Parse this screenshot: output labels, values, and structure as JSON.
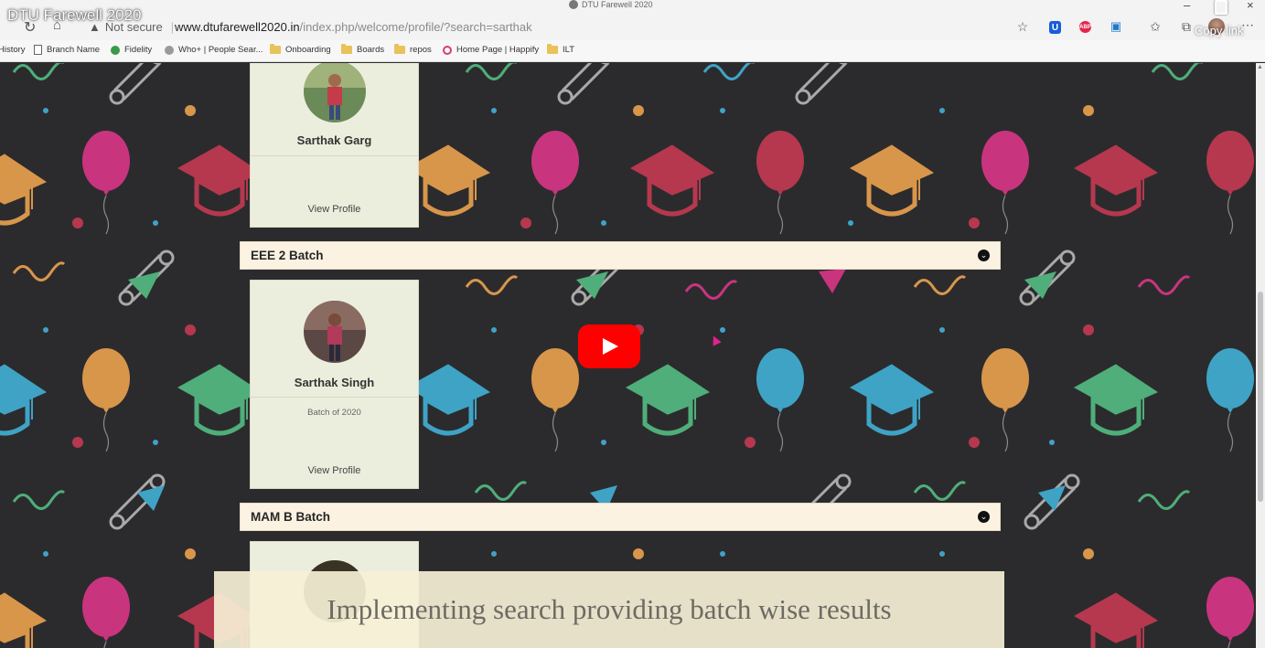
{
  "video": {
    "title": "DTU Farewell 2020",
    "copy_link": "Copy link"
  },
  "window": {
    "title": "DTU Farewell 2020"
  },
  "addressbar": {
    "security_label": "Not secure",
    "url_domain": "www.dtufarewell2020.in",
    "url_path": "/index.php/welcome/profile/?search=sarthak"
  },
  "bookmarks": [
    {
      "label": "History",
      "icon": "none"
    },
    {
      "label": "Branch Name",
      "icon": "document-icon"
    },
    {
      "label": "Fidelity",
      "icon": "fidelity-icon"
    },
    {
      "label": "Who+ | People Sear...",
      "icon": "who-icon"
    },
    {
      "label": "Onboarding",
      "icon": "folder-icon"
    },
    {
      "label": "Boards",
      "icon": "folder-icon"
    },
    {
      "label": "repos",
      "icon": "folder-icon"
    },
    {
      "label": "Home Page | Happify",
      "icon": "happify-icon"
    },
    {
      "label": "ILT",
      "icon": "folder-icon"
    }
  ],
  "profiles": [
    {
      "name": "Sarthak Garg",
      "batch_text": "",
      "view_label": "View Profile"
    },
    {
      "name": "Sarthak Singh",
      "batch_text": "Batch of 2020",
      "view_label": "View Profile"
    }
  ],
  "batches": [
    {
      "label": "EEE 2 Batch",
      "toggle_icon": "chevron-down-circle-icon"
    },
    {
      "label": "MAM B Batch",
      "toggle_icon": "chevron-down-circle-icon"
    }
  ],
  "caption": {
    "text": "Implementing search providing batch wise results"
  },
  "colors": {
    "page_background": "#2b2b2d",
    "card_background": "#eceedd",
    "batch_bar_background": "#fbf2e2",
    "youtube_red": "#ff0000",
    "balloon_pink": "#c9347f",
    "balloon_red": "#b5384f",
    "balloon_orange": "#d8964b",
    "balloon_blue": "#3fa3c6",
    "cap_green": "#4fae7a"
  }
}
